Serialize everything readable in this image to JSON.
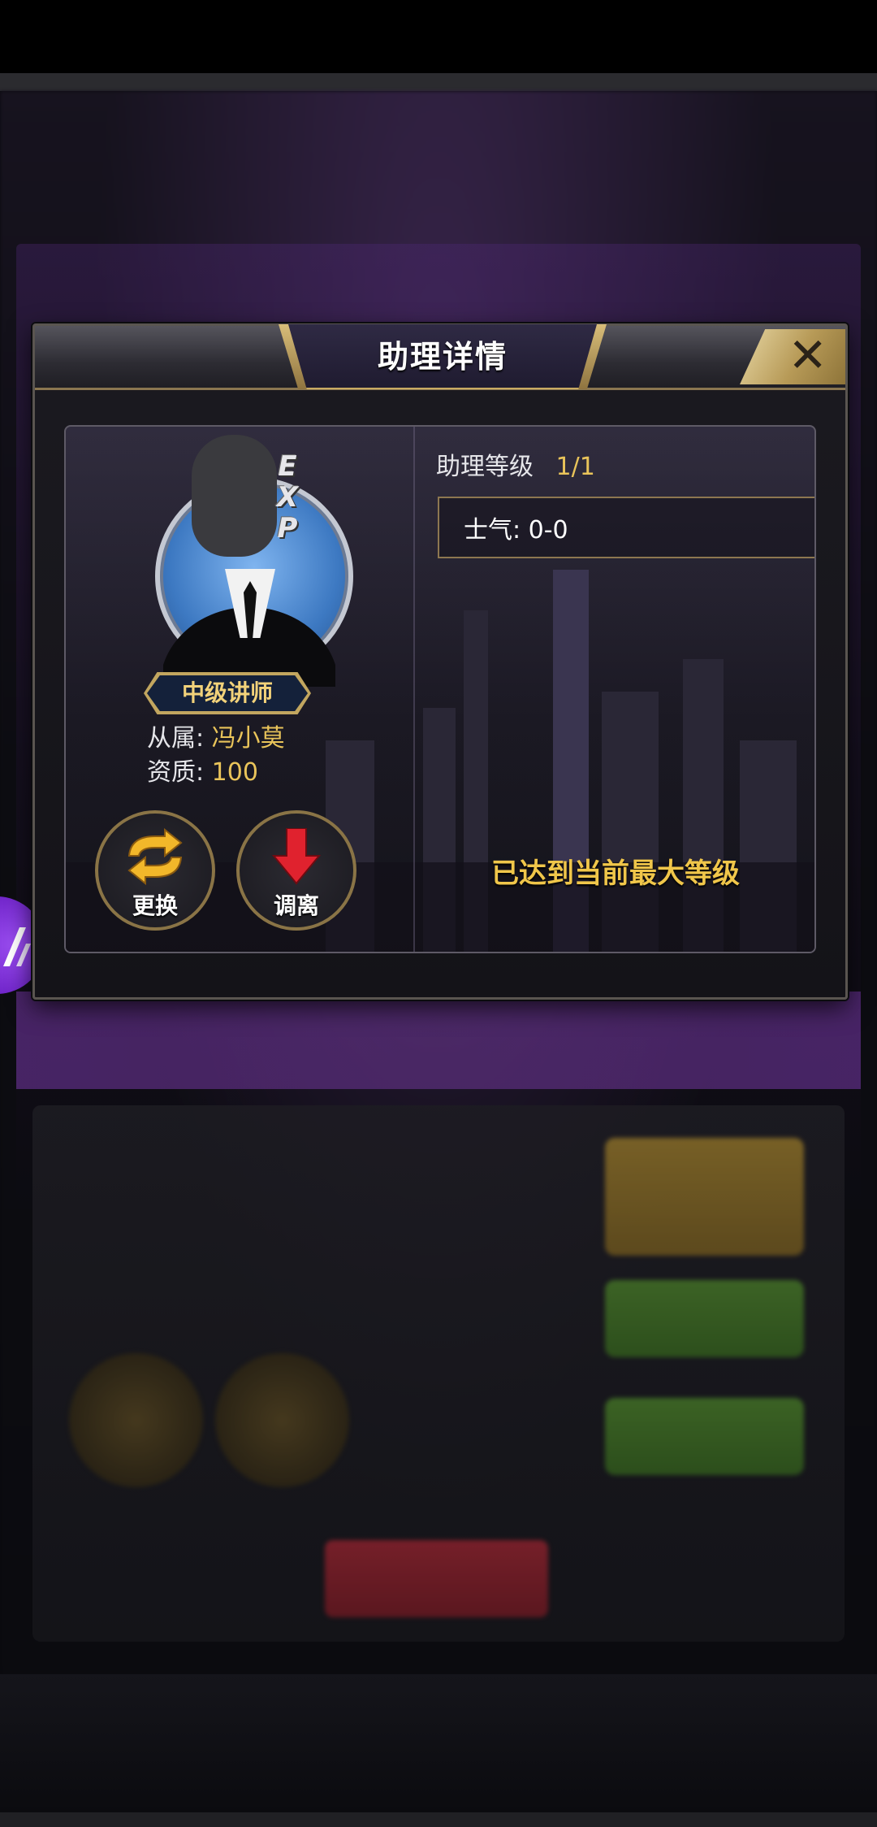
{
  "dialog": {
    "title": "助理详情",
    "close_icon": "close-icon"
  },
  "assistant": {
    "exp_badge": "EXP",
    "rank": "中级讲师",
    "affiliation_label": "从属:",
    "affiliation_value": "冯小莫",
    "aptitude_label": "资质:",
    "aptitude_value": "100",
    "level_label": "助理等级",
    "level_value": "1/1",
    "morale": "士气: 0-0",
    "max_level_notice": "已达到当前最大等级"
  },
  "actions": {
    "replace_label": "更换",
    "transfer_label": "调离"
  },
  "colors": {
    "gold": "#e9c45a",
    "accent_notice": "#f0c64a",
    "frame": "#8a7650"
  }
}
